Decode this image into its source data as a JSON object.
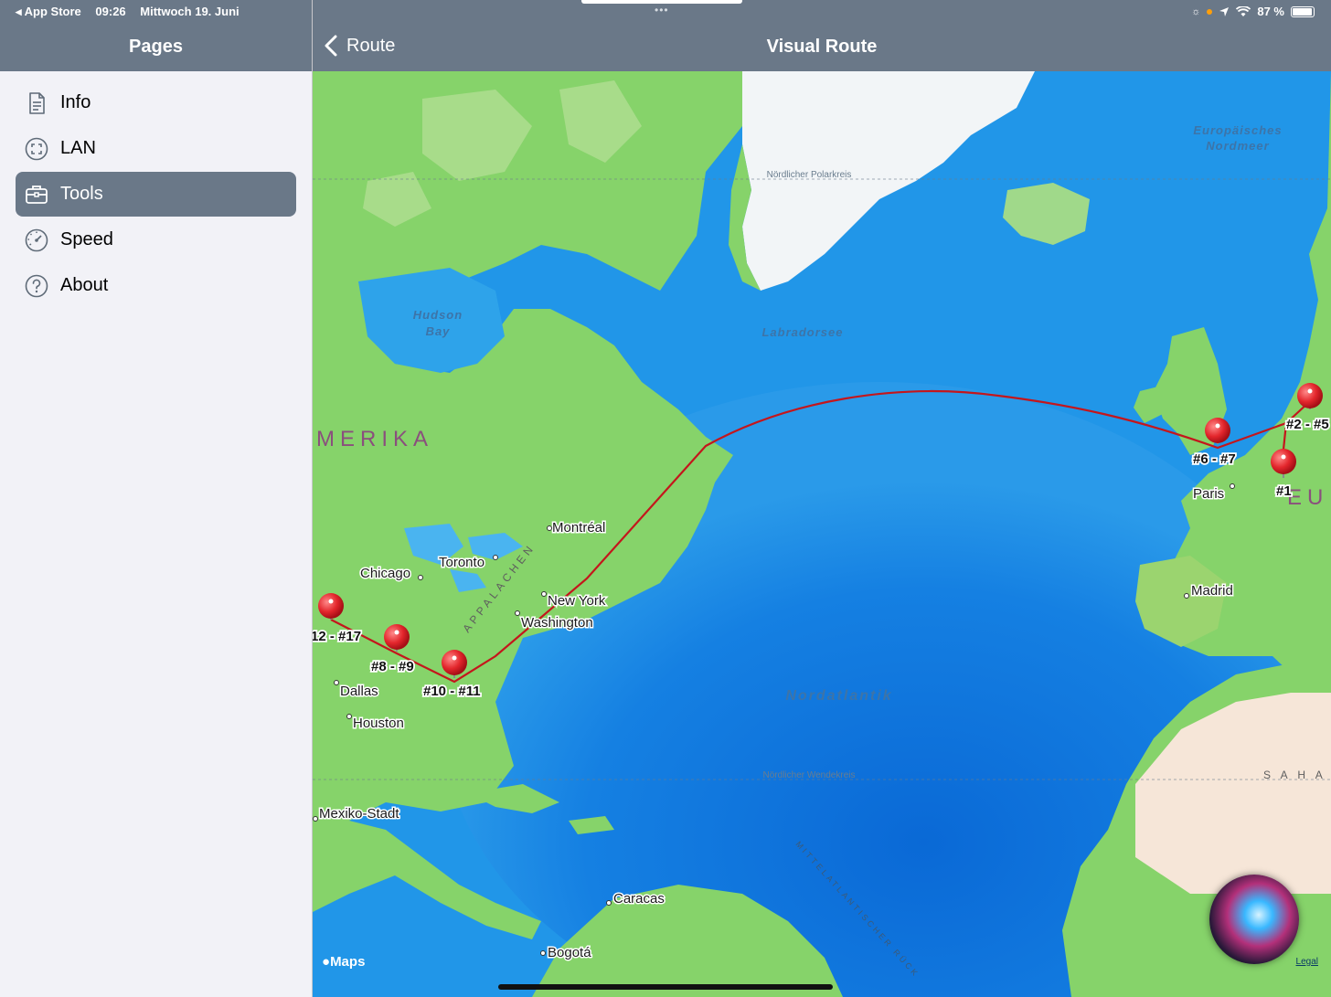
{
  "status_bar": {
    "back_app": "◂ App Store",
    "time": "09:26",
    "date": "Mittwoch 19. Juni",
    "battery": "87 %"
  },
  "sidebar": {
    "title": "Pages",
    "items": [
      {
        "label": "Info",
        "icon": "document-icon",
        "active": false
      },
      {
        "label": "LAN",
        "icon": "lan-icon",
        "active": false
      },
      {
        "label": "Tools",
        "icon": "briefcase-icon",
        "active": true
      },
      {
        "label": "Speed",
        "icon": "speedometer-icon",
        "active": false
      },
      {
        "label": "About",
        "icon": "question-icon",
        "active": false
      }
    ]
  },
  "nav": {
    "back_label": "Route",
    "title": "Visual Route"
  },
  "map": {
    "water_labels": [
      "Europäisches",
      "Nordmeer",
      "Hudson",
      "Bay",
      "Labradorsee",
      "Nordatlantik"
    ],
    "lines": [
      "Nördlicher Polarkreis",
      "Nördlicher Wendekreis"
    ],
    "regions": [
      "MERIKA",
      "EU",
      "S A H A",
      "APPALACHEN",
      "MITTELATLANTISCHER RÜCK"
    ],
    "cities": [
      "Montréal",
      "Toronto",
      "Chicago",
      "New York",
      "Washington",
      "Dallas",
      "Houston",
      "Mexiko-Stadt",
      "Caracas",
      "Bogotá",
      "Paris",
      "Madrid"
    ],
    "pins": [
      "12 - #17",
      "#8 - #9",
      "#10 - #11",
      "#6 - #7",
      "#2 - #5",
      "#1"
    ],
    "attribution": "Maps",
    "legal": "Legal"
  },
  "colors": {
    "bar": "#6a7888",
    "route": "#c4161c",
    "ocean": "#1e8ee6",
    "land": "#86d36a",
    "ice": "#ffffff"
  }
}
